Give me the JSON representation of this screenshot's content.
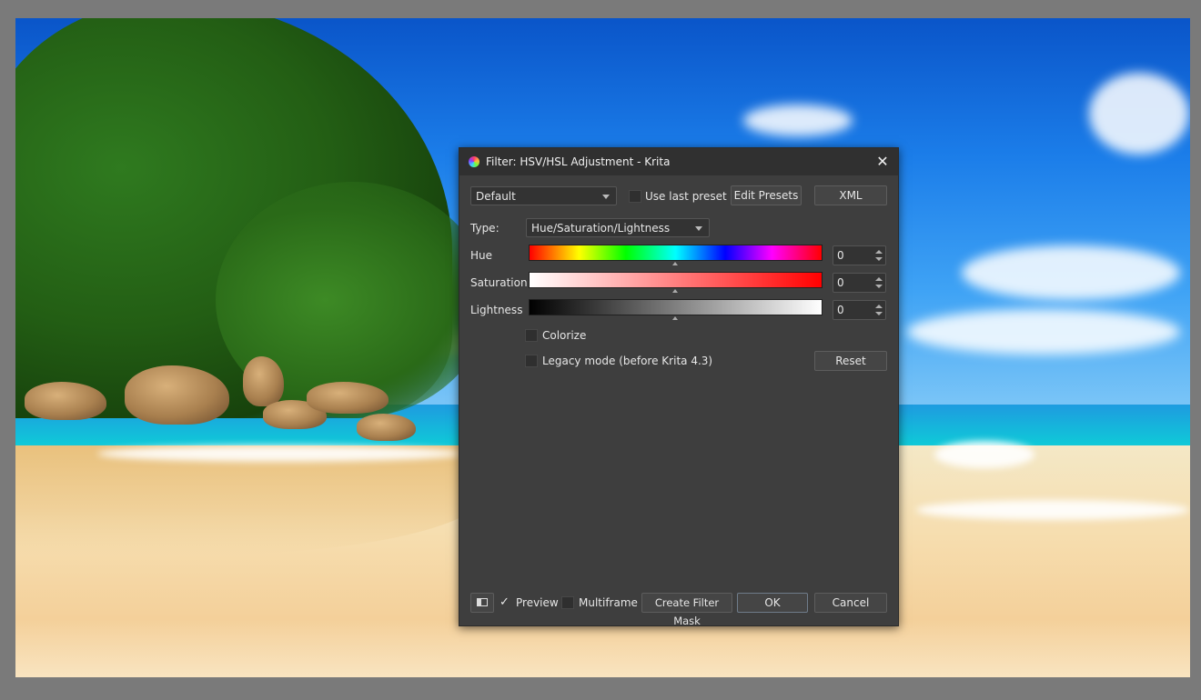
{
  "dialog": {
    "title": "Filter: HSV/HSL Adjustment - Krita",
    "close_glyph": "✕",
    "preset": {
      "selected": "Default"
    },
    "use_last_preset": {
      "label": "Use last preset",
      "checked": false
    },
    "edit_presets_label": "Edit Presets",
    "xml_label": "XML",
    "type": {
      "label": "Type:",
      "selected": "Hue/Saturation/Lightness"
    },
    "hue": {
      "label": "Hue",
      "value": "0"
    },
    "saturation": {
      "label": "Saturation",
      "value": "0"
    },
    "lightness": {
      "label": "Lightness",
      "value": "0"
    },
    "colorize": {
      "label": "Colorize",
      "checked": false
    },
    "legacy_mode": {
      "label": "Legacy mode (before Krita 4.3)",
      "checked": false
    },
    "reset_label": "Reset",
    "footer": {
      "preview": {
        "label": "Preview",
        "checked": true,
        "check_glyph": "✓"
      },
      "multiframe": {
        "label": "Multiframe",
        "checked": false
      },
      "create_filter_mask_label": "Create Filter Mask",
      "ok_label": "OK",
      "cancel_label": "Cancel"
    }
  },
  "icons": {
    "app": "krita-logo-icon",
    "close": "close-icon",
    "layout_toggle": "split-view-icon"
  },
  "colors": {
    "dialog_bg": "#3e3e3e",
    "titlebar_bg": "#303030",
    "workspace_bg": "#7a7a7a"
  }
}
